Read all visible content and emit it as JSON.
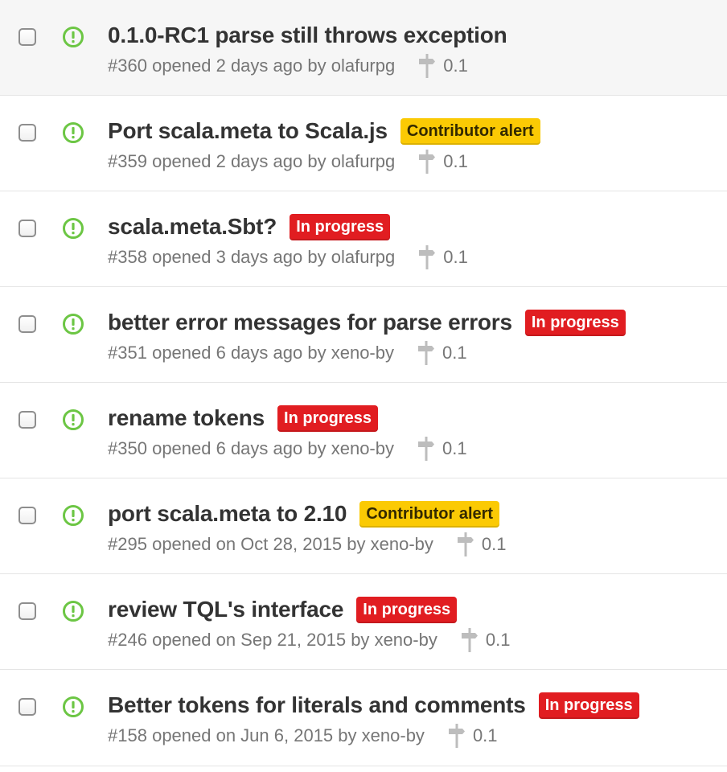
{
  "colors": {
    "open_icon": "#6cc644",
    "label_red": "#e11d21",
    "label_yellow": "#fbca04",
    "meta_text": "#767676",
    "title_text": "#333333"
  },
  "issues": [
    {
      "title": "0.1.0-RC1 parse still throws exception",
      "number": "#360",
      "opened": "opened 2 days ago by",
      "author": "olafurpg",
      "milestone": "0.1",
      "label": null,
      "label_color": null,
      "highlight": true
    },
    {
      "title": "Port scala.meta to Scala.js",
      "number": "#359",
      "opened": "opened 2 days ago by",
      "author": "olafurpg",
      "milestone": "0.1",
      "label": "Contributor alert",
      "label_color": "yellow",
      "highlight": false
    },
    {
      "title": "scala.meta.Sbt?",
      "number": "#358",
      "opened": "opened 3 days ago by",
      "author": "olafurpg",
      "milestone": "0.1",
      "label": "In progress",
      "label_color": "red",
      "highlight": false
    },
    {
      "title": "better error messages for parse errors",
      "number": "#351",
      "opened": "opened 6 days ago by",
      "author": "xeno-by",
      "milestone": "0.1",
      "label": "In progress",
      "label_color": "red",
      "highlight": false
    },
    {
      "title": "rename tokens",
      "number": "#350",
      "opened": "opened 6 days ago by",
      "author": "xeno-by",
      "milestone": "0.1",
      "label": "In progress",
      "label_color": "red",
      "highlight": false
    },
    {
      "title": "port scala.meta to 2.10",
      "number": "#295",
      "opened": "opened on Oct 28, 2015 by",
      "author": "xeno-by",
      "milestone": "0.1",
      "label": "Contributor alert",
      "label_color": "yellow",
      "highlight": false
    },
    {
      "title": "review TQL's interface",
      "number": "#246",
      "opened": "opened on Sep 21, 2015 by",
      "author": "xeno-by",
      "milestone": "0.1",
      "label": "In progress",
      "label_color": "red",
      "highlight": false
    },
    {
      "title": "Better tokens for literals and comments",
      "number": "#158",
      "opened": "opened on Jun 6, 2015 by",
      "author": "xeno-by",
      "milestone": "0.1",
      "label": "In progress",
      "label_color": "red",
      "highlight": false
    }
  ]
}
